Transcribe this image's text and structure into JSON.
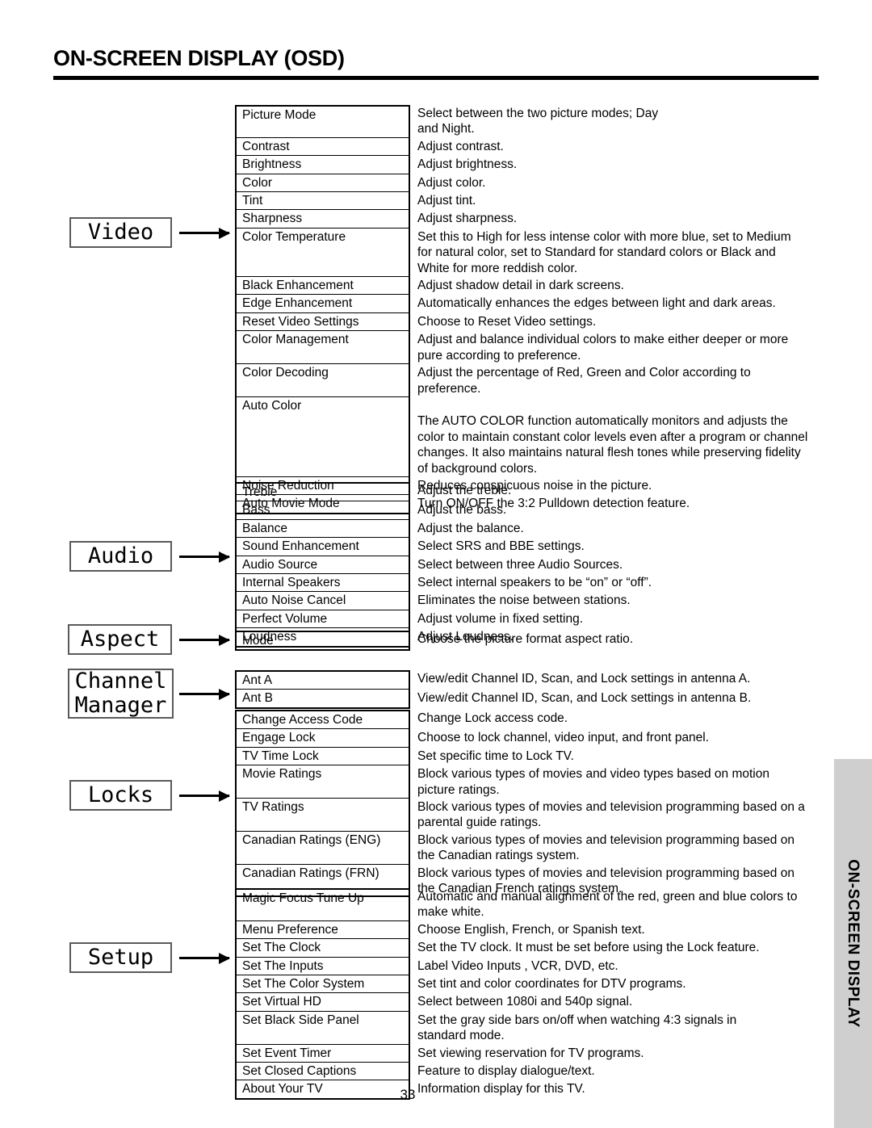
{
  "page": {
    "title": "ON-SCREEN DISPLAY (OSD)",
    "number": "33",
    "side_tab_label": "ON-SCREEN DISPLAY"
  },
  "categories": {
    "video": "Video",
    "audio": "Audio",
    "aspect": "Aspect",
    "channel_manager_line1": "Channel",
    "channel_manager_line2": "Manager",
    "locks": "Locks",
    "setup": "Setup"
  },
  "groups": [
    {
      "id": "video",
      "category": "Video",
      "rows": [
        {
          "term": "Picture Mode",
          "desc": [
            "Select between the two picture modes; Day",
            "and Night."
          ]
        },
        {
          "term": "Contrast",
          "desc": [
            "Adjust contrast."
          ]
        },
        {
          "term": "Brightness",
          "desc": [
            "Adjust brightness."
          ]
        },
        {
          "term": "Color",
          "desc": [
            "Adjust color."
          ]
        },
        {
          "term": "Tint",
          "desc": [
            "Adjust tint."
          ]
        },
        {
          "term": "Sharpness",
          "desc": [
            "Adjust sharpness."
          ]
        },
        {
          "term": "Color Temperature",
          "desc": [
            "Set this to High for less intense color with more blue, set to Medium",
            "for natural color, set to Standard for standard colors or Black and",
            "White for more reddish color."
          ]
        },
        {
          "term": "Black Enhancement",
          "desc": [
            "Adjust shadow detail in dark screens."
          ]
        },
        {
          "term": "Edge Enhancement",
          "desc": [
            "Automatically enhances the edges between light and dark areas."
          ]
        },
        {
          "term": "Reset Video Settings",
          "desc": [
            "Choose to Reset Video settings."
          ]
        },
        {
          "term": "Color Management",
          "desc": [
            "Adjust and balance individual colors to make either deeper or more",
            "pure according to preference."
          ]
        },
        {
          "term": "Color Decoding",
          "desc": [
            "Adjust the percentage of Red, Green and Color according to",
            "preference."
          ]
        },
        {
          "term": "Auto Color",
          "desc": [
            "",
            "The AUTO COLOR function automatically monitors and adjusts the",
            "color to maintain constant color levels even after a program or channel",
            "changes. It also maintains natural flesh tones while preserving fidelity",
            "of background colors."
          ]
        },
        {
          "term": "Noise Reduction",
          "desc": [
            "Reduces conspicuous noise in the picture."
          ]
        },
        {
          "term": "Auto Movie Mode",
          "desc": [
            "Turn ON/OFF the 3:2 Pulldown detection feature."
          ]
        }
      ]
    },
    {
      "id": "audio",
      "category": "Audio",
      "rows": [
        {
          "term": "Treble",
          "desc": [
            "Adjust the treble."
          ]
        },
        {
          "term": "Bass",
          "desc": [
            "Adjust the bass."
          ]
        },
        {
          "term": "Balance",
          "desc": [
            "Adjust the balance."
          ]
        },
        {
          "term": "Sound Enhancement",
          "desc": [
            "Select SRS and BBE settings."
          ]
        },
        {
          "term": "Audio Source",
          "desc": [
            "Select between three Audio Sources."
          ]
        },
        {
          "term": "Internal Speakers",
          "desc": [
            "Select internal speakers to be “on” or “off”."
          ]
        },
        {
          "term": "Auto Noise Cancel",
          "desc": [
            "Eliminates the noise between stations."
          ]
        },
        {
          "term": "Perfect Volume",
          "desc": [
            "Adjust volume in fixed setting."
          ]
        },
        {
          "term": "Loudness",
          "desc": [
            "Adjust Loudness."
          ]
        }
      ]
    },
    {
      "id": "aspect",
      "category": "Aspect",
      "rows": [
        {
          "term": "Mode",
          "desc": [
            "Choose the picture format aspect ratio."
          ]
        }
      ]
    },
    {
      "id": "channel",
      "category": "Channel Manager",
      "rows": [
        {
          "term": "Ant A",
          "desc": [
            "View/edit Channel ID, Scan, and Lock settings in antenna A."
          ]
        },
        {
          "term": "Ant B",
          "desc": [
            "View/edit Channel ID, Scan, and Lock settings in antenna B."
          ]
        }
      ]
    },
    {
      "id": "locks",
      "category": "Locks",
      "rows": [
        {
          "term": "Change Access Code",
          "desc": [
            "Change Lock access code."
          ]
        },
        {
          "term": "Engage Lock",
          "desc": [
            "Choose to lock channel, video input, and front panel."
          ]
        },
        {
          "term": "TV Time Lock",
          "desc": [
            "Set specific time to Lock TV."
          ]
        },
        {
          "term": "Movie Ratings",
          "desc": [
            "Block various types of movies and video types based on motion",
            "picture ratings."
          ]
        },
        {
          "term": "TV Ratings",
          "desc": [
            "Block various types of movies and television programming based on a",
            "parental guide ratings."
          ]
        },
        {
          "term": "Canadian Ratings (ENG)",
          "desc": [
            "Block various types of movies and television programming based on",
            "the Canadian ratings system."
          ]
        },
        {
          "term": "Canadian Ratings (FRN)",
          "desc": [
            "Block various types of movies and television programming based on",
            "the Canadian French ratings system."
          ]
        }
      ]
    },
    {
      "id": "setup",
      "category": "Setup",
      "rows": [
        {
          "term": "Magic Focus Tune Up",
          "desc": [
            "Automatic and manual alignment of the red, green and blue colors to",
            "make white."
          ]
        },
        {
          "term": "Menu Preference",
          "desc": [
            "Choose English, French, or Spanish text."
          ]
        },
        {
          "term": "Set The Clock",
          "desc": [
            "Set the TV clock.  It must be set before using the Lock feature."
          ]
        },
        {
          "term": "Set The Inputs",
          "desc": [
            "Label Video Inputs , VCR, DVD, etc."
          ]
        },
        {
          "term": "Set The Color System",
          "desc": [
            "Set tint and color coordinates for DTV programs."
          ]
        },
        {
          "term": "Set Virtual HD",
          "desc": [
            "Select between 1080i and 540p signal."
          ]
        },
        {
          "term": "Set Black Side Panel",
          "desc": [
            "Set the gray side bars on/off when watching 4:3 signals in",
            "standard mode."
          ]
        },
        {
          "term": "Set Event Timer",
          "desc": [
            "Set viewing reservation for TV programs."
          ]
        },
        {
          "term": "Set Closed Captions",
          "desc": [
            "Feature to display dialogue/text."
          ]
        },
        {
          "term": "About Your TV",
          "desc": [
            "Information display for this TV."
          ]
        }
      ]
    }
  ]
}
